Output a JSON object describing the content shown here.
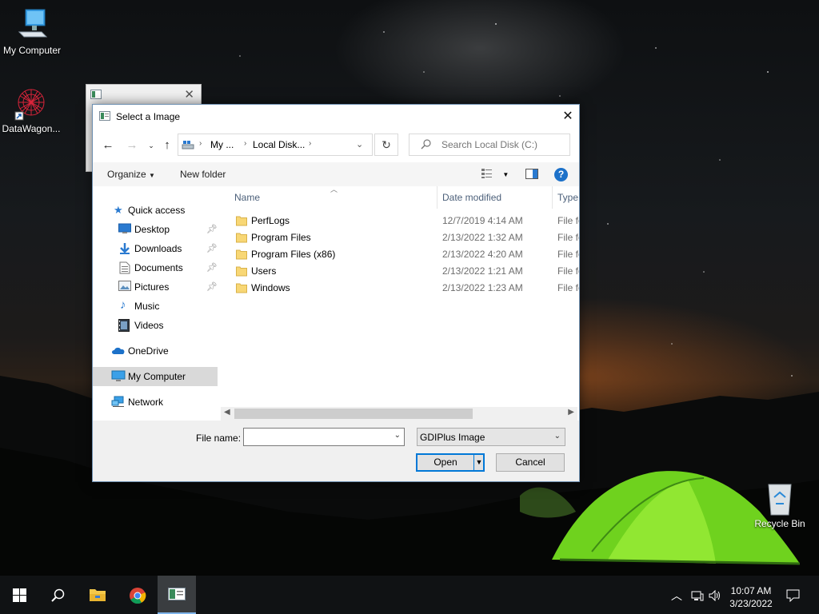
{
  "desktop": {
    "icons": [
      {
        "label": "My Computer",
        "icon": "computer-icon"
      },
      {
        "label": "DataWagon...",
        "icon": "datawagon-app-icon"
      },
      {
        "label": "Recycle Bin",
        "icon": "recycle-bin-icon"
      }
    ]
  },
  "dialog": {
    "title": "Select a Image",
    "close_glyph": "✕",
    "breadcrumb": [
      "My ...",
      "Local Disk..."
    ],
    "search_placeholder": "Search Local Disk (C:)",
    "toolbar": {
      "organize": "Organize",
      "new_folder": "New folder",
      "help": "?"
    },
    "nav": {
      "quick_access": "Quick access",
      "items": [
        {
          "label": "Desktop",
          "icon": "desktop-icon",
          "pinned": true
        },
        {
          "label": "Downloads",
          "icon": "downloads-icon",
          "pinned": true
        },
        {
          "label": "Documents",
          "icon": "documents-icon",
          "pinned": true
        },
        {
          "label": "Pictures",
          "icon": "pictures-icon",
          "pinned": true
        },
        {
          "label": "Music",
          "icon": "music-icon",
          "pinned": false
        },
        {
          "label": "Videos",
          "icon": "videos-icon",
          "pinned": false
        }
      ],
      "onedrive": "OneDrive",
      "my_computer": "My Computer",
      "network": "Network"
    },
    "columns": {
      "name": "Name",
      "date_modified": "Date modified",
      "type": "Type"
    },
    "files": [
      {
        "name": "PerfLogs",
        "date": "12/7/2019 4:14 AM",
        "type": "File fo"
      },
      {
        "name": "Program Files",
        "date": "2/13/2022 1:32 AM",
        "type": "File fo"
      },
      {
        "name": "Program Files (x86)",
        "date": "2/13/2022 4:20 AM",
        "type": "File fo"
      },
      {
        "name": "Users",
        "date": "2/13/2022 1:21 AM",
        "type": "File fo"
      },
      {
        "name": "Windows",
        "date": "2/13/2022 1:23 AM",
        "type": "File fo"
      }
    ],
    "file_name_label": "File name:",
    "file_name_value": "",
    "file_type": "GDIPlus Image",
    "open_button": "Open",
    "cancel_button": "Cancel"
  },
  "taskbar": {
    "time": "10:07 AM",
    "date": "3/23/2022"
  },
  "colors": {
    "accent": "#0078d7",
    "selection": "#d9d9d9",
    "folder": "#f8d775"
  }
}
